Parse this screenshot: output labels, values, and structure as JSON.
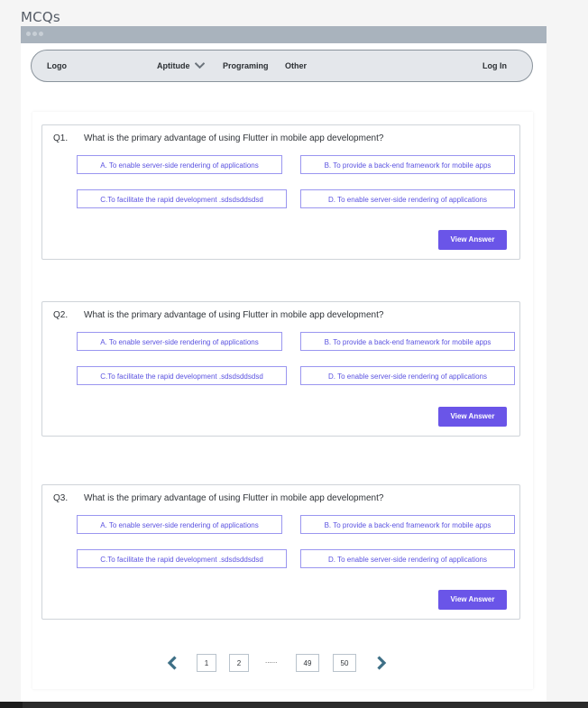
{
  "page": {
    "label": "MCQs"
  },
  "nav": {
    "logo": "Logo",
    "aptitude": "Aptitude",
    "programing": "Programing",
    "other": "Other",
    "login": "Log In"
  },
  "questions": [
    {
      "number": "Q1.",
      "text": "What is the primary advantage of using Flutter in mobile app development?",
      "options": {
        "a": "A. To enable server-side rendering of applications",
        "b": "B. To provide a back-end framework for mobile apps",
        "c": "C.To facilitate the rapid development .sdsdsddsdsd",
        "d": "D. To enable server-side rendering of applications"
      },
      "button": "View Answer"
    },
    {
      "number": "Q2.",
      "text": "What is the primary advantage of using Flutter in mobile app development?",
      "options": {
        "a": "A. To enable server-side rendering of applications",
        "b": "B. To provide a back-end framework for mobile apps",
        "c": "C.To facilitate the rapid development .sdsdsddsdsd",
        "d": "D. To enable server-side rendering of applications"
      },
      "button": "View Answer"
    },
    {
      "number": "Q3.",
      "text": "What is the primary advantage of using Flutter in mobile app development?",
      "options": {
        "a": "A. To enable server-side rendering of applications",
        "b": "B. To provide a back-end framework for mobile apps",
        "c": "C.To facilitate the rapid development .sdsdsddsdsd",
        "d": "D. To enable server-side rendering of applications"
      },
      "button": "View Answer"
    }
  ],
  "pagination": {
    "pages": [
      "1",
      "2",
      "49",
      "50"
    ],
    "ellipsis": "......",
    "prev_icon": "chevron-left-icon",
    "next_icon": "chevron-right-icon"
  },
  "colors": {
    "accent": "#6a55e8",
    "option_text": "#5a52e0",
    "arrow": "#3d6f86",
    "titlebar": "#a9b3bd"
  }
}
